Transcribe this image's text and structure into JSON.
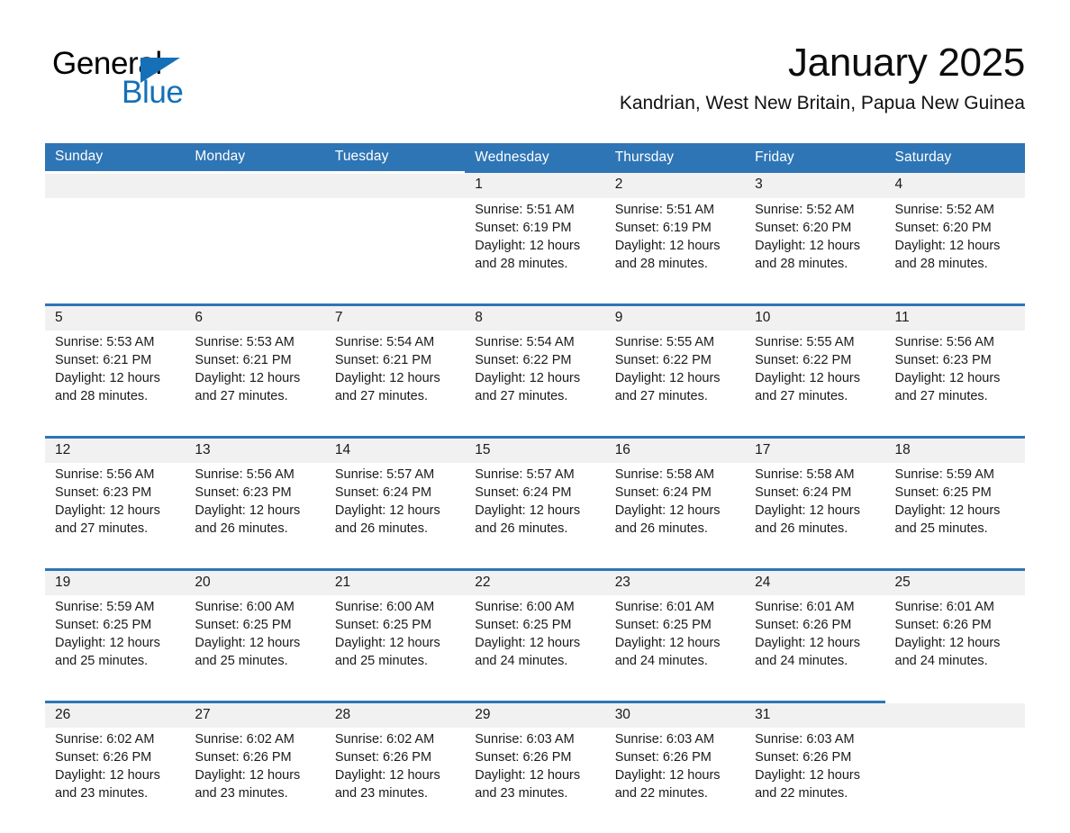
{
  "brand": {
    "name_part1": "General",
    "name_part2": "Blue",
    "triangle_icon": "blue-triangle-logo-mark",
    "accent_color": "#1570b8"
  },
  "header": {
    "title": "January 2025",
    "subtitle": "Kandrian, West New Britain, Papua New Guinea"
  },
  "theme": {
    "header_blue": "#2e75b5",
    "day_band_gray": "#f1f1f1",
    "text_black": "#1a1a1a"
  },
  "calendar": {
    "weekday_headers": [
      "Sunday",
      "Monday",
      "Tuesday",
      "Wednesday",
      "Thursday",
      "Friday",
      "Saturday"
    ],
    "labels": {
      "sunrise_prefix": "Sunrise:",
      "sunset_prefix": "Sunset:",
      "daylight_prefix": "Daylight:"
    },
    "weeks": [
      [
        {
          "day": "",
          "empty": true
        },
        {
          "day": "",
          "empty": true
        },
        {
          "day": "",
          "empty": true
        },
        {
          "day": "1",
          "line1": "Sunrise: 5:51 AM",
          "line2": "Sunset: 6:19 PM",
          "line3": "Daylight: 12 hours",
          "line4": "and 28 minutes."
        },
        {
          "day": "2",
          "line1": "Sunrise: 5:51 AM",
          "line2": "Sunset: 6:19 PM",
          "line3": "Daylight: 12 hours",
          "line4": "and 28 minutes."
        },
        {
          "day": "3",
          "line1": "Sunrise: 5:52 AM",
          "line2": "Sunset: 6:20 PM",
          "line3": "Daylight: 12 hours",
          "line4": "and 28 minutes."
        },
        {
          "day": "4",
          "line1": "Sunrise: 5:52 AM",
          "line2": "Sunset: 6:20 PM",
          "line3": "Daylight: 12 hours",
          "line4": "and 28 minutes."
        }
      ],
      [
        {
          "day": "5",
          "line1": "Sunrise: 5:53 AM",
          "line2": "Sunset: 6:21 PM",
          "line3": "Daylight: 12 hours",
          "line4": "and 28 minutes."
        },
        {
          "day": "6",
          "line1": "Sunrise: 5:53 AM",
          "line2": "Sunset: 6:21 PM",
          "line3": "Daylight: 12 hours",
          "line4": "and 27 minutes."
        },
        {
          "day": "7",
          "line1": "Sunrise: 5:54 AM",
          "line2": "Sunset: 6:21 PM",
          "line3": "Daylight: 12 hours",
          "line4": "and 27 minutes."
        },
        {
          "day": "8",
          "line1": "Sunrise: 5:54 AM",
          "line2": "Sunset: 6:22 PM",
          "line3": "Daylight: 12 hours",
          "line4": "and 27 minutes."
        },
        {
          "day": "9",
          "line1": "Sunrise: 5:55 AM",
          "line2": "Sunset: 6:22 PM",
          "line3": "Daylight: 12 hours",
          "line4": "and 27 minutes."
        },
        {
          "day": "10",
          "line1": "Sunrise: 5:55 AM",
          "line2": "Sunset: 6:22 PM",
          "line3": "Daylight: 12 hours",
          "line4": "and 27 minutes."
        },
        {
          "day": "11",
          "line1": "Sunrise: 5:56 AM",
          "line2": "Sunset: 6:23 PM",
          "line3": "Daylight: 12 hours",
          "line4": "and 27 minutes."
        }
      ],
      [
        {
          "day": "12",
          "line1": "Sunrise: 5:56 AM",
          "line2": "Sunset: 6:23 PM",
          "line3": "Daylight: 12 hours",
          "line4": "and 27 minutes."
        },
        {
          "day": "13",
          "line1": "Sunrise: 5:56 AM",
          "line2": "Sunset: 6:23 PM",
          "line3": "Daylight: 12 hours",
          "line4": "and 26 minutes."
        },
        {
          "day": "14",
          "line1": "Sunrise: 5:57 AM",
          "line2": "Sunset: 6:24 PM",
          "line3": "Daylight: 12 hours",
          "line4": "and 26 minutes."
        },
        {
          "day": "15",
          "line1": "Sunrise: 5:57 AM",
          "line2": "Sunset: 6:24 PM",
          "line3": "Daylight: 12 hours",
          "line4": "and 26 minutes."
        },
        {
          "day": "16",
          "line1": "Sunrise: 5:58 AM",
          "line2": "Sunset: 6:24 PM",
          "line3": "Daylight: 12 hours",
          "line4": "and 26 minutes."
        },
        {
          "day": "17",
          "line1": "Sunrise: 5:58 AM",
          "line2": "Sunset: 6:24 PM",
          "line3": "Daylight: 12 hours",
          "line4": "and 26 minutes."
        },
        {
          "day": "18",
          "line1": "Sunrise: 5:59 AM",
          "line2": "Sunset: 6:25 PM",
          "line3": "Daylight: 12 hours",
          "line4": "and 25 minutes."
        }
      ],
      [
        {
          "day": "19",
          "line1": "Sunrise: 5:59 AM",
          "line2": "Sunset: 6:25 PM",
          "line3": "Daylight: 12 hours",
          "line4": "and 25 minutes."
        },
        {
          "day": "20",
          "line1": "Sunrise: 6:00 AM",
          "line2": "Sunset: 6:25 PM",
          "line3": "Daylight: 12 hours",
          "line4": "and 25 minutes."
        },
        {
          "day": "21",
          "line1": "Sunrise: 6:00 AM",
          "line2": "Sunset: 6:25 PM",
          "line3": "Daylight: 12 hours",
          "line4": "and 25 minutes."
        },
        {
          "day": "22",
          "line1": "Sunrise: 6:00 AM",
          "line2": "Sunset: 6:25 PM",
          "line3": "Daylight: 12 hours",
          "line4": "and 24 minutes."
        },
        {
          "day": "23",
          "line1": "Sunrise: 6:01 AM",
          "line2": "Sunset: 6:25 PM",
          "line3": "Daylight: 12 hours",
          "line4": "and 24 minutes."
        },
        {
          "day": "24",
          "line1": "Sunrise: 6:01 AM",
          "line2": "Sunset: 6:26 PM",
          "line3": "Daylight: 12 hours",
          "line4": "and 24 minutes."
        },
        {
          "day": "25",
          "line1": "Sunrise: 6:01 AM",
          "line2": "Sunset: 6:26 PM",
          "line3": "Daylight: 12 hours",
          "line4": "and 24 minutes."
        }
      ],
      [
        {
          "day": "26",
          "line1": "Sunrise: 6:02 AM",
          "line2": "Sunset: 6:26 PM",
          "line3": "Daylight: 12 hours",
          "line4": "and 23 minutes."
        },
        {
          "day": "27",
          "line1": "Sunrise: 6:02 AM",
          "line2": "Sunset: 6:26 PM",
          "line3": "Daylight: 12 hours",
          "line4": "and 23 minutes."
        },
        {
          "day": "28",
          "line1": "Sunrise: 6:02 AM",
          "line2": "Sunset: 6:26 PM",
          "line3": "Daylight: 12 hours",
          "line4": "and 23 minutes."
        },
        {
          "day": "29",
          "line1": "Sunrise: 6:03 AM",
          "line2": "Sunset: 6:26 PM",
          "line3": "Daylight: 12 hours",
          "line4": "and 23 minutes."
        },
        {
          "day": "30",
          "line1": "Sunrise: 6:03 AM",
          "line2": "Sunset: 6:26 PM",
          "line3": "Daylight: 12 hours",
          "line4": "and 22 minutes."
        },
        {
          "day": "31",
          "line1": "Sunrise: 6:03 AM",
          "line2": "Sunset: 6:26 PM",
          "line3": "Daylight: 12 hours",
          "line4": "and 22 minutes."
        },
        {
          "day": "",
          "empty": true
        }
      ]
    ]
  }
}
